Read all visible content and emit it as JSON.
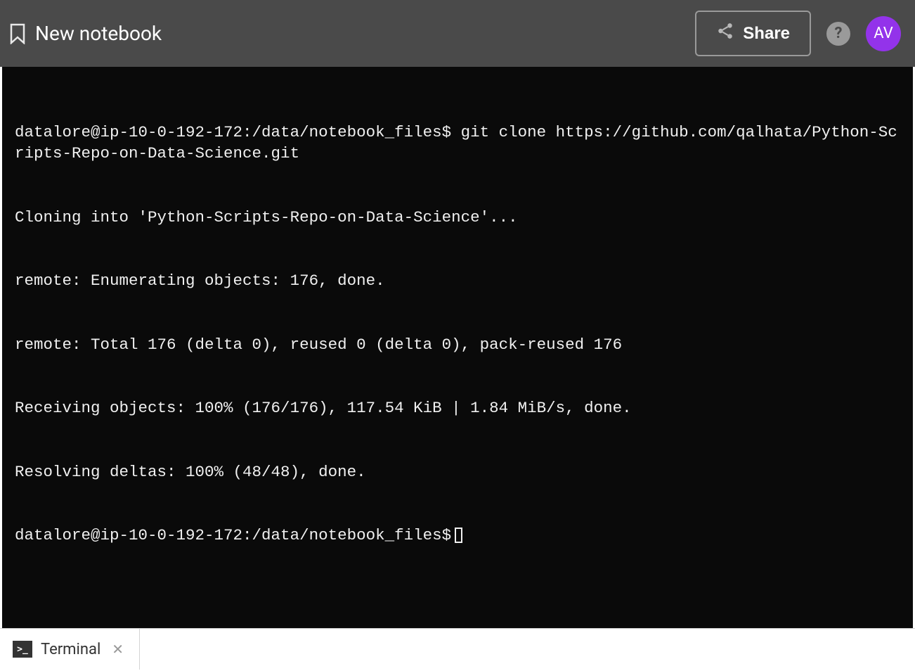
{
  "header": {
    "title": "New notebook",
    "share_label": "Share",
    "help_label": "?",
    "avatar_initials": "AV"
  },
  "terminal": {
    "lines": [
      "datalore@ip-10-0-192-172:/data/notebook_files$ git clone https://github.com/qalhata/Python-Scripts-Repo-on-Data-Science.git",
      "Cloning into 'Python-Scripts-Repo-on-Data-Science'...",
      "remote: Enumerating objects: 176, done.",
      "remote: Total 176 (delta 0), reused 0 (delta 0), pack-reused 176",
      "Receiving objects: 100% (176/176), 117.54 KiB | 1.84 MiB/s, done.",
      "Resolving deltas: 100% (48/48), done."
    ],
    "prompt": "datalore@ip-10-0-192-172:/data/notebook_files$"
  },
  "footer": {
    "tab_label": "Terminal",
    "tab_icon_glyph": ">_"
  }
}
